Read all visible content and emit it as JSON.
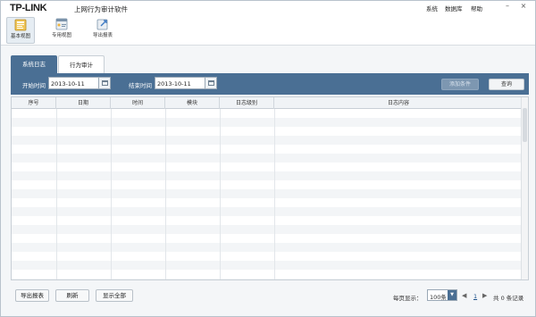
{
  "header": {
    "logo": "TP-LINK",
    "title": "上网行为审计软件",
    "menu": [
      "系统",
      "数据库",
      "帮助"
    ],
    "window_controls": {
      "minimize": "–",
      "close": "×"
    }
  },
  "toolbar": {
    "items": [
      {
        "label": "基本视图",
        "icon": "basic-view-icon",
        "active": true
      },
      {
        "label": "专用视图",
        "icon": "special-view-icon",
        "active": false
      },
      {
        "label": "导出报表",
        "icon": "export-report-icon",
        "active": false
      }
    ]
  },
  "tabs": [
    {
      "label": "系统日志",
      "active": true
    },
    {
      "label": "行为审计",
      "active": false
    }
  ],
  "filter": {
    "start_label": "开始时间",
    "start_value": "2013-10-11",
    "end_label": "结束时间",
    "end_value": "2013-10-11",
    "add_condition": "添加条件",
    "query": "查询"
  },
  "table": {
    "columns": [
      "序号",
      "日期",
      "时间",
      "模块",
      "日志级别",
      "日志内容"
    ],
    "rows": []
  },
  "footer": {
    "export": "导出报表",
    "refresh": "刷新",
    "show_all": "显示全部",
    "per_page_label": "每页显示：",
    "per_page_value": "100条",
    "page_prev": "◀",
    "page_number": "1",
    "page_next": "▶",
    "total": "共 0 条记录"
  },
  "colors": {
    "accent": "#4a6f94",
    "header_bg": "#f0f3f6",
    "stripe": "#f3f5f7"
  }
}
